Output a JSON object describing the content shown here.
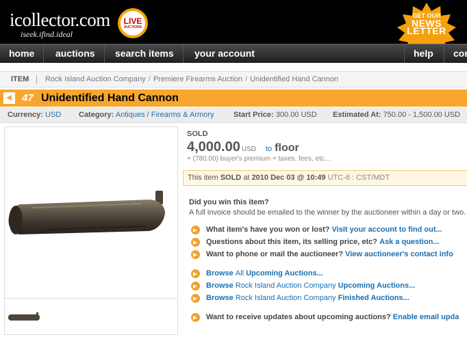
{
  "header": {
    "logo": "icollector.com",
    "tagline": "iseek.ifind.ideal",
    "live_badge_line1": "LIVE",
    "live_badge_line2": "AUCTIONS",
    "newsletter_line1": "GET OUR",
    "newsletter_line2": "NEWS",
    "newsletter_line3": "LETTER"
  },
  "nav": {
    "items": [
      "home",
      "auctions",
      "search items",
      "your account"
    ],
    "right_items": [
      "help",
      "cor"
    ]
  },
  "breadcrumb": {
    "label": "ITEM",
    "path": [
      "Rock Island Auction Company",
      "Premiere Firearms Auction",
      "Unidentified Hand Cannon"
    ]
  },
  "lot": {
    "number": "47",
    "title": "Unidentified Hand Cannon"
  },
  "info": {
    "currency_label": "Currency:",
    "currency_value": "USD",
    "category_label": "Category:",
    "category_value": "Antiques / Firearms & Armory",
    "start_label": "Start Price:",
    "start_value": "300.00 USD",
    "estimate_label": "Estimated At:",
    "estimate_value": "750.00 - 1,500.00 USD"
  },
  "result": {
    "status": "SOLD",
    "price": "4,000.00",
    "currency": "USD",
    "to": "to",
    "buyer": "floor",
    "premium": "+ (780.00) buyer's premium + taxes, fees, etc..."
  },
  "soldbox": {
    "prefix": "This item",
    "status": "SOLD",
    "at": "at",
    "datetime": "2010 Dec 03 @ 10:49",
    "timezone": "UTC-6 : CST/MDT"
  },
  "win": {
    "question": "Did you win this item?",
    "answer": "A full invoice should be emailed to the winner by the auctioneer within a day or two."
  },
  "links": {
    "q1": "What item's have you won or lost?",
    "a1": "Visit your account to find out...",
    "q2": "Questions about this item, its selling price, etc?",
    "a2": "Ask a question...",
    "q3": "Want to phone or mail the auctioneer?",
    "a3": "View auctioneer's contact info",
    "browse": "Browse",
    "all": "All",
    "upcoming_auctions": "Upcoming Auctions...",
    "company": "Rock Island Auction Company",
    "finished_auctions": "Finished Auctions...",
    "q4": "Want to receive updates about upcoming auctions?",
    "a4": "Enable email upda"
  },
  "colors": {
    "accent_orange": "#f7a62e",
    "link_blue": "#1a6fb0",
    "header_black": "#000000"
  }
}
